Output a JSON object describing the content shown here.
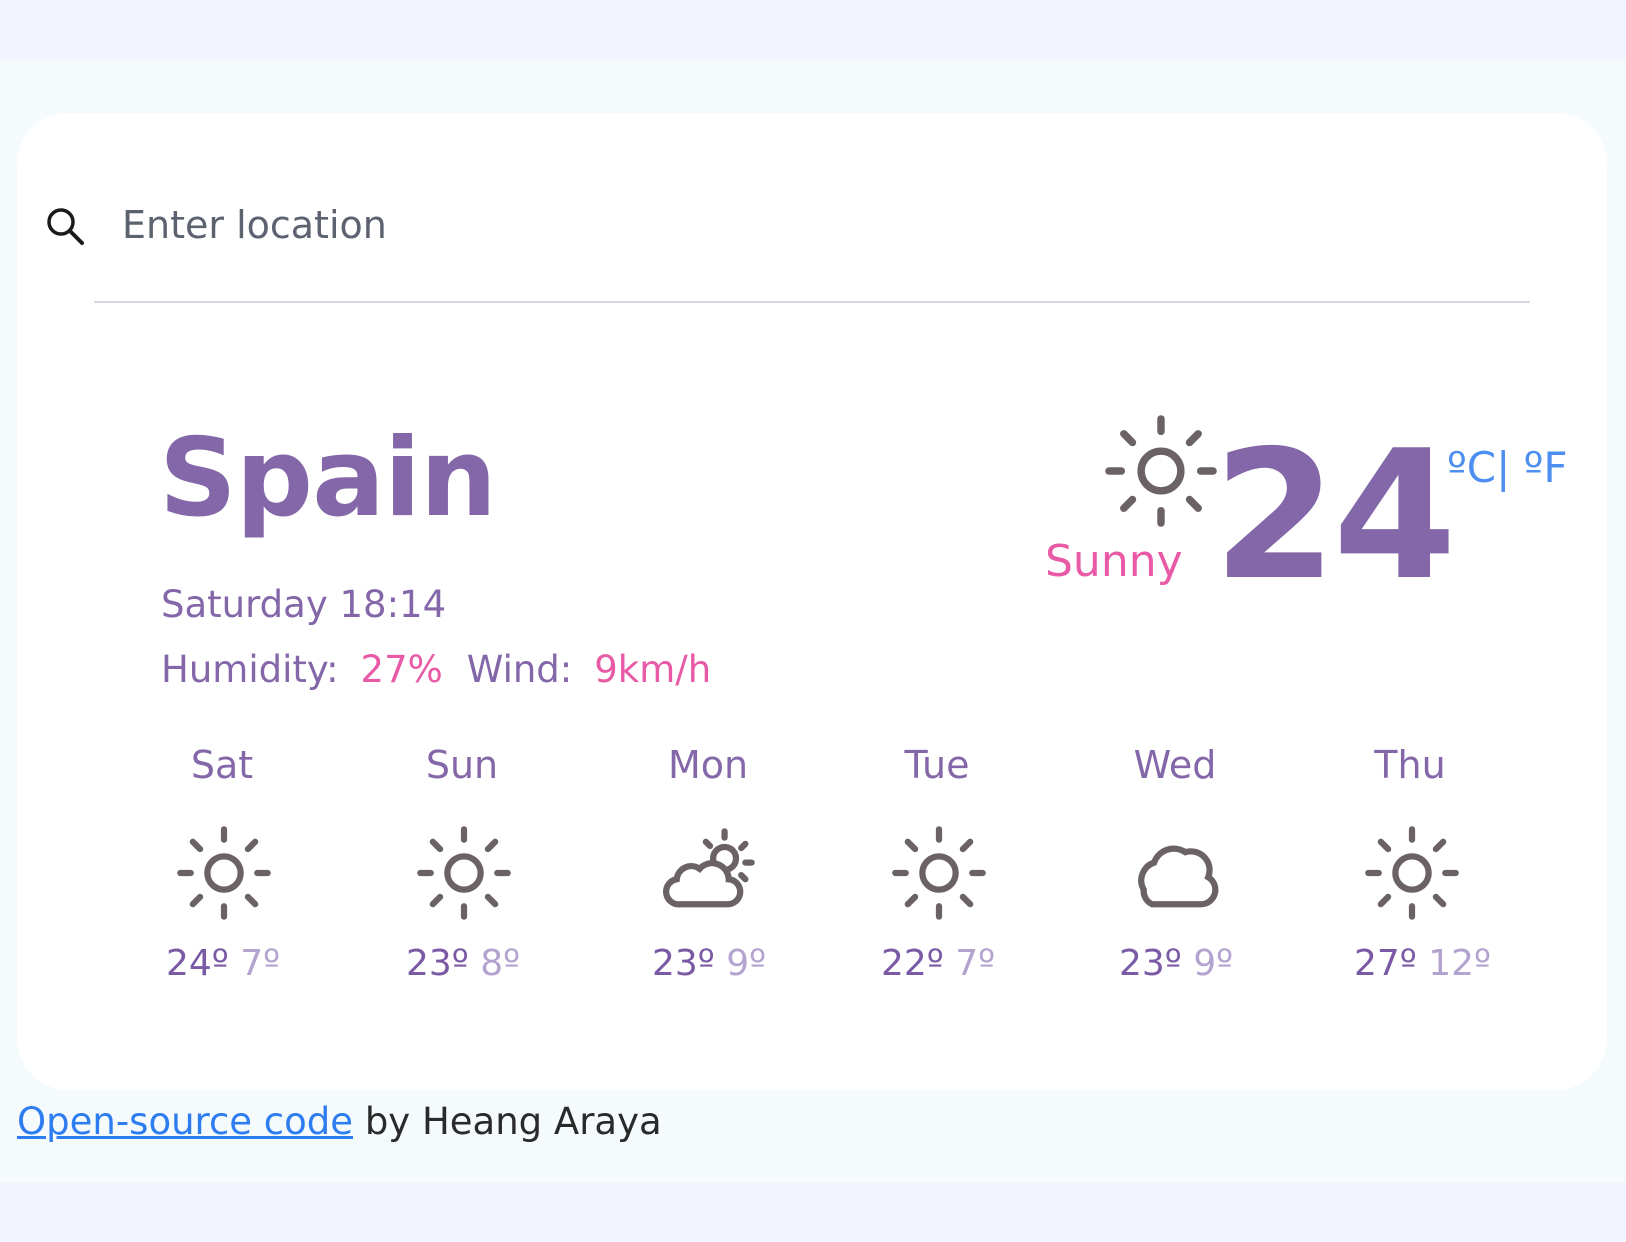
{
  "search": {
    "placeholder": "Enter location",
    "value": ""
  },
  "current": {
    "city": "Spain",
    "datetime": "Saturday 18:14",
    "humidity_label": "Humidity:",
    "humidity_value": "27%",
    "wind_label": "Wind:",
    "wind_value": "9km/h",
    "condition": "Sunny",
    "icon": "sun-icon",
    "temperature": "24",
    "unit_c": "ºC",
    "unit_separator": "|",
    "unit_f": "ºF"
  },
  "forecast": [
    {
      "day": "Sat",
      "icon": "sun-icon",
      "high": "24º",
      "low": "7º"
    },
    {
      "day": "Sun",
      "icon": "sun-icon",
      "high": "23º",
      "low": "8º"
    },
    {
      "day": "Mon",
      "icon": "partly-cloudy-icon",
      "high": "23º",
      "low": "9º"
    },
    {
      "day": "Tue",
      "icon": "sun-icon",
      "high": "22º",
      "low": "7º"
    },
    {
      "day": "Wed",
      "icon": "cloud-icon",
      "high": "23º",
      "low": "9º"
    },
    {
      "day": "Thu",
      "icon": "sun-icon",
      "high": "27º",
      "low": "12º"
    }
  ],
  "footer": {
    "link_text": "Open-source code",
    "suffix": "by Heang Araya"
  },
  "colors": {
    "primary": "#8467a8",
    "accent": "#e85aa6",
    "link": "#2d7cf0",
    "icon": "#6b6266"
  }
}
